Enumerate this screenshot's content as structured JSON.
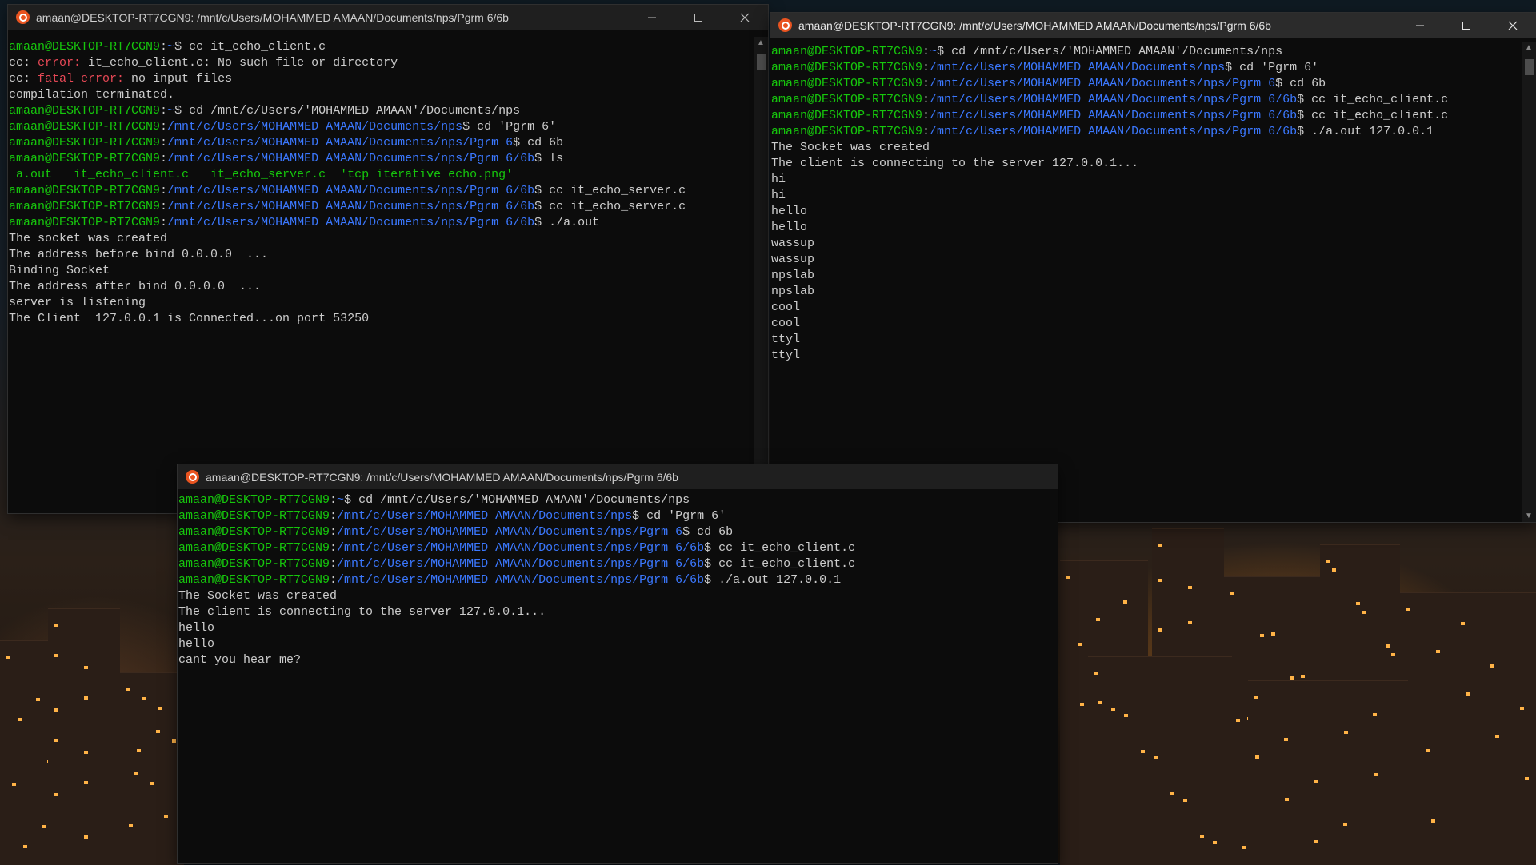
{
  "wallpaper": "night-city",
  "colors": {
    "prompt_user": "#16c60c",
    "prompt_path": "#3b78ff",
    "error": "#e74856",
    "text": "#cccccc",
    "background": "#0c0c0c"
  },
  "windows": [
    {
      "title": "amaan@DESKTOP-RT7CGN9: /mnt/c/Users/MOHAMMED AMAAN/Documents/nps/Pgrm 6/6b",
      "lines": [
        [
          [
            "amaan@DESKTOP-RT7CGN9",
            "g"
          ],
          [
            ":",
            "w"
          ],
          [
            "~",
            "b"
          ],
          [
            "$ cc it_echo_client.c",
            "w"
          ]
        ],
        [
          [
            "cc: ",
            "w"
          ],
          [
            "error:",
            "r"
          ],
          [
            " it_echo_client.c: No such file or directory",
            "w"
          ]
        ],
        [
          [
            "cc: ",
            "w"
          ],
          [
            "fatal error:",
            "r"
          ],
          [
            " no input files",
            "w"
          ]
        ],
        [
          [
            "compilation terminated.",
            "w"
          ]
        ],
        [
          [
            "amaan@DESKTOP-RT7CGN9",
            "g"
          ],
          [
            ":",
            "w"
          ],
          [
            "~",
            "b"
          ],
          [
            "$ cd /mnt/c/Users/'MOHAMMED AMAAN'/Documents/nps",
            "w"
          ]
        ],
        [
          [
            "amaan@DESKTOP-RT7CGN9",
            "g"
          ],
          [
            ":",
            "w"
          ],
          [
            "/mnt/c/Users/MOHAMMED AMAAN/Documents/nps",
            "b"
          ],
          [
            "$ cd 'Pgrm 6'",
            "w"
          ]
        ],
        [
          [
            "amaan@DESKTOP-RT7CGN9",
            "g"
          ],
          [
            ":",
            "w"
          ],
          [
            "/mnt/c/Users/MOHAMMED AMAAN/Documents/nps/Pgrm 6",
            "b"
          ],
          [
            "$ cd 6b",
            "w"
          ]
        ],
        [
          [
            "amaan@DESKTOP-RT7CGN9",
            "g"
          ],
          [
            ":",
            "w"
          ],
          [
            "/mnt/c/Users/MOHAMMED AMAAN/Documents/nps/Pgrm 6/6b",
            "b"
          ],
          [
            "$ ls",
            "w"
          ]
        ],
        [
          [
            " a.out   it_echo_client.c   it_echo_server.c  'tcp iterative echo.png'",
            "g"
          ]
        ],
        [
          [
            "amaan@DESKTOP-RT7CGN9",
            "g"
          ],
          [
            ":",
            "w"
          ],
          [
            "/mnt/c/Users/MOHAMMED AMAAN/Documents/nps/Pgrm 6/6b",
            "b"
          ],
          [
            "$ cc it_echo_server.c",
            "w"
          ]
        ],
        [
          [
            "amaan@DESKTOP-RT7CGN9",
            "g"
          ],
          [
            ":",
            "w"
          ],
          [
            "/mnt/c/Users/MOHAMMED AMAAN/Documents/nps/Pgrm 6/6b",
            "b"
          ],
          [
            "$ cc it_echo_server.c",
            "w"
          ]
        ],
        [
          [
            "amaan@DESKTOP-RT7CGN9",
            "g"
          ],
          [
            ":",
            "w"
          ],
          [
            "/mnt/c/Users/MOHAMMED AMAAN/Documents/nps/Pgrm 6/6b",
            "b"
          ],
          [
            "$ ./a.out",
            "w"
          ]
        ],
        [
          [
            "The socket was created",
            "w"
          ]
        ],
        [
          [
            "The address before bind 0.0.0.0  ...",
            "w"
          ]
        ],
        [
          [
            "Binding Socket",
            "w"
          ]
        ],
        [
          [
            "The address after bind 0.0.0.0  ...",
            "w"
          ]
        ],
        [
          [
            "server is listening",
            "w"
          ]
        ],
        [
          [
            "The Client  127.0.0.1 is Connected...on port 53250",
            "w"
          ]
        ]
      ]
    },
    {
      "title": "amaan@DESKTOP-RT7CGN9: /mnt/c/Users/MOHAMMED AMAAN/Documents/nps/Pgrm 6/6b",
      "lines": [
        [
          [
            "amaan@DESKTOP-RT7CGN9",
            "g"
          ],
          [
            ":",
            "w"
          ],
          [
            "~",
            "b"
          ],
          [
            "$ cd /mnt/c/Users/'MOHAMMED AMAAN'/Documents/nps",
            "w"
          ]
        ],
        [
          [
            "amaan@DESKTOP-RT7CGN9",
            "g"
          ],
          [
            ":",
            "w"
          ],
          [
            "/mnt/c/Users/MOHAMMED AMAAN/Documents/nps",
            "b"
          ],
          [
            "$ cd 'Pgrm 6'",
            "w"
          ]
        ],
        [
          [
            "amaan@DESKTOP-RT7CGN9",
            "g"
          ],
          [
            ":",
            "w"
          ],
          [
            "/mnt/c/Users/MOHAMMED AMAAN/Documents/nps/Pgrm 6",
            "b"
          ],
          [
            "$ cd 6b",
            "w"
          ]
        ],
        [
          [
            "amaan@DESKTOP-RT7CGN9",
            "g"
          ],
          [
            ":",
            "w"
          ],
          [
            "/mnt/c/Users/MOHAMMED AMAAN/Documents/nps/Pgrm 6/6b",
            "b"
          ],
          [
            "$ cc it_echo_client.c",
            "w"
          ]
        ],
        [
          [
            "amaan@DESKTOP-RT7CGN9",
            "g"
          ],
          [
            ":",
            "w"
          ],
          [
            "/mnt/c/Users/MOHAMMED AMAAN/Documents/nps/Pgrm 6/6b",
            "b"
          ],
          [
            "$ cc it_echo_client.c",
            "w"
          ]
        ],
        [
          [
            "amaan@DESKTOP-RT7CGN9",
            "g"
          ],
          [
            ":",
            "w"
          ],
          [
            "/mnt/c/Users/MOHAMMED AMAAN/Documents/nps/Pgrm 6/6b",
            "b"
          ],
          [
            "$ ./a.out 127.0.0.1",
            "w"
          ]
        ],
        [
          [
            "The Socket was created",
            "w"
          ]
        ],
        [
          [
            "The client is connecting to the server 127.0.0.1...",
            "w"
          ]
        ],
        [
          [
            "hi",
            "w"
          ]
        ],
        [
          [
            "hi",
            "w"
          ]
        ],
        [
          [
            "hello",
            "w"
          ]
        ],
        [
          [
            "hello",
            "w"
          ]
        ],
        [
          [
            "wassup",
            "w"
          ]
        ],
        [
          [
            "wassup",
            "w"
          ]
        ],
        [
          [
            "npslab",
            "w"
          ]
        ],
        [
          [
            "npslab",
            "w"
          ]
        ],
        [
          [
            "cool",
            "w"
          ]
        ],
        [
          [
            "cool",
            "w"
          ]
        ],
        [
          [
            "ttyl",
            "w"
          ]
        ],
        [
          [
            "ttyl",
            "w"
          ]
        ]
      ]
    },
    {
      "title": "amaan@DESKTOP-RT7CGN9: /mnt/c/Users/MOHAMMED AMAAN/Documents/nps/Pgrm 6/6b",
      "lines": [
        [
          [
            "amaan@DESKTOP-RT7CGN9",
            "g"
          ],
          [
            ":",
            "w"
          ],
          [
            "~",
            "b"
          ],
          [
            "$ cd /mnt/c/Users/'MOHAMMED AMAAN'/Documents/nps",
            "w"
          ]
        ],
        [
          [
            "amaan@DESKTOP-RT7CGN9",
            "g"
          ],
          [
            ":",
            "w"
          ],
          [
            "/mnt/c/Users/MOHAMMED AMAAN/Documents/nps",
            "b"
          ],
          [
            "$ cd 'Pgrm 6'",
            "w"
          ]
        ],
        [
          [
            "amaan@DESKTOP-RT7CGN9",
            "g"
          ],
          [
            ":",
            "w"
          ],
          [
            "/mnt/c/Users/MOHAMMED AMAAN/Documents/nps/Pgrm 6",
            "b"
          ],
          [
            "$ cd 6b",
            "w"
          ]
        ],
        [
          [
            "amaan@DESKTOP-RT7CGN9",
            "g"
          ],
          [
            ":",
            "w"
          ],
          [
            "/mnt/c/Users/MOHAMMED AMAAN/Documents/nps/Pgrm 6/6b",
            "b"
          ],
          [
            "$ cc it_echo_client.c",
            "w"
          ]
        ],
        [
          [
            "amaan@DESKTOP-RT7CGN9",
            "g"
          ],
          [
            ":",
            "w"
          ],
          [
            "/mnt/c/Users/MOHAMMED AMAAN/Documents/nps/Pgrm 6/6b",
            "b"
          ],
          [
            "$ cc it_echo_client.c",
            "w"
          ]
        ],
        [
          [
            "amaan@DESKTOP-RT7CGN9",
            "g"
          ],
          [
            ":",
            "w"
          ],
          [
            "/mnt/c/Users/MOHAMMED AMAAN/Documents/nps/Pgrm 6/6b",
            "b"
          ],
          [
            "$ ./a.out 127.0.0.1",
            "w"
          ]
        ],
        [
          [
            "The Socket was created",
            "w"
          ]
        ],
        [
          [
            "The client is connecting to the server 127.0.0.1...",
            "w"
          ]
        ],
        [
          [
            "hello",
            "w"
          ]
        ],
        [
          [
            "hello",
            "w"
          ]
        ],
        [
          [
            "cant you hear me?",
            "w"
          ]
        ]
      ]
    }
  ]
}
